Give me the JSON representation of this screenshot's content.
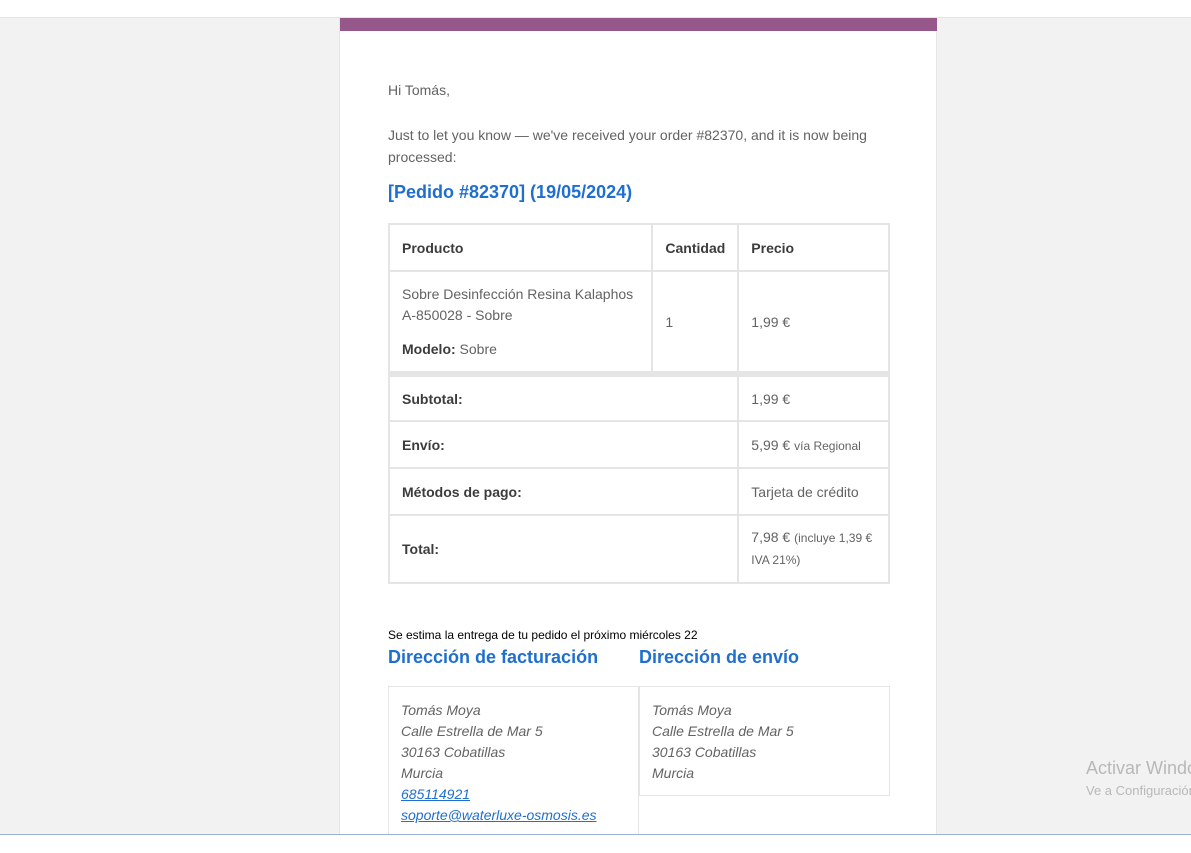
{
  "email": {
    "greeting": "Hi Tomás,",
    "intro": "Just to let you know — we've received your order #82370, and it is now being processed:",
    "order_heading": "[Pedido #82370] (19/05/2024)",
    "table": {
      "headers": [
        "Producto",
        "Cantidad",
        "Precio"
      ],
      "item": {
        "name": "Sobre Desinfección Resina Kalaphos A-850028 - Sobre",
        "meta_label": "Modelo:",
        "meta_value": "Sobre",
        "quantity": "1",
        "price": "1,99 €"
      },
      "totals": [
        {
          "label": "Subtotal:",
          "value": "1,99 €",
          "note": ""
        },
        {
          "label": "Envío:",
          "value": "5,99 €",
          "note": "vía Regional"
        },
        {
          "label": "Métodos de pago:",
          "value": "Tarjeta de crédito",
          "note": ""
        },
        {
          "label": "Total:",
          "value": "7,98 €",
          "note": "(incluye 1,39 € IVA 21%)"
        }
      ]
    },
    "delivery_note": "Se estima la entrega de tu pedido el próximo miércoles 22",
    "billing": {
      "title": "Dirección de facturación",
      "name": "Tomás Moya",
      "street": "Calle Estrella de Mar 5",
      "city": "30163 Cobatillas",
      "region": "Murcia",
      "phone": "685114921",
      "email": "soporte@waterluxe-osmosis.es"
    },
    "shipping": {
      "title": "Dirección de envío",
      "name": "Tomás Moya",
      "street": "Calle Estrella de Mar 5",
      "city": "30163 Cobatillas",
      "region": "Murcia"
    }
  },
  "watermark": {
    "title": "Activar Windows",
    "subtitle": "Ve a Configuración"
  },
  "colors": {
    "brand_band": "#96588a",
    "link": "#1f6fd0"
  }
}
